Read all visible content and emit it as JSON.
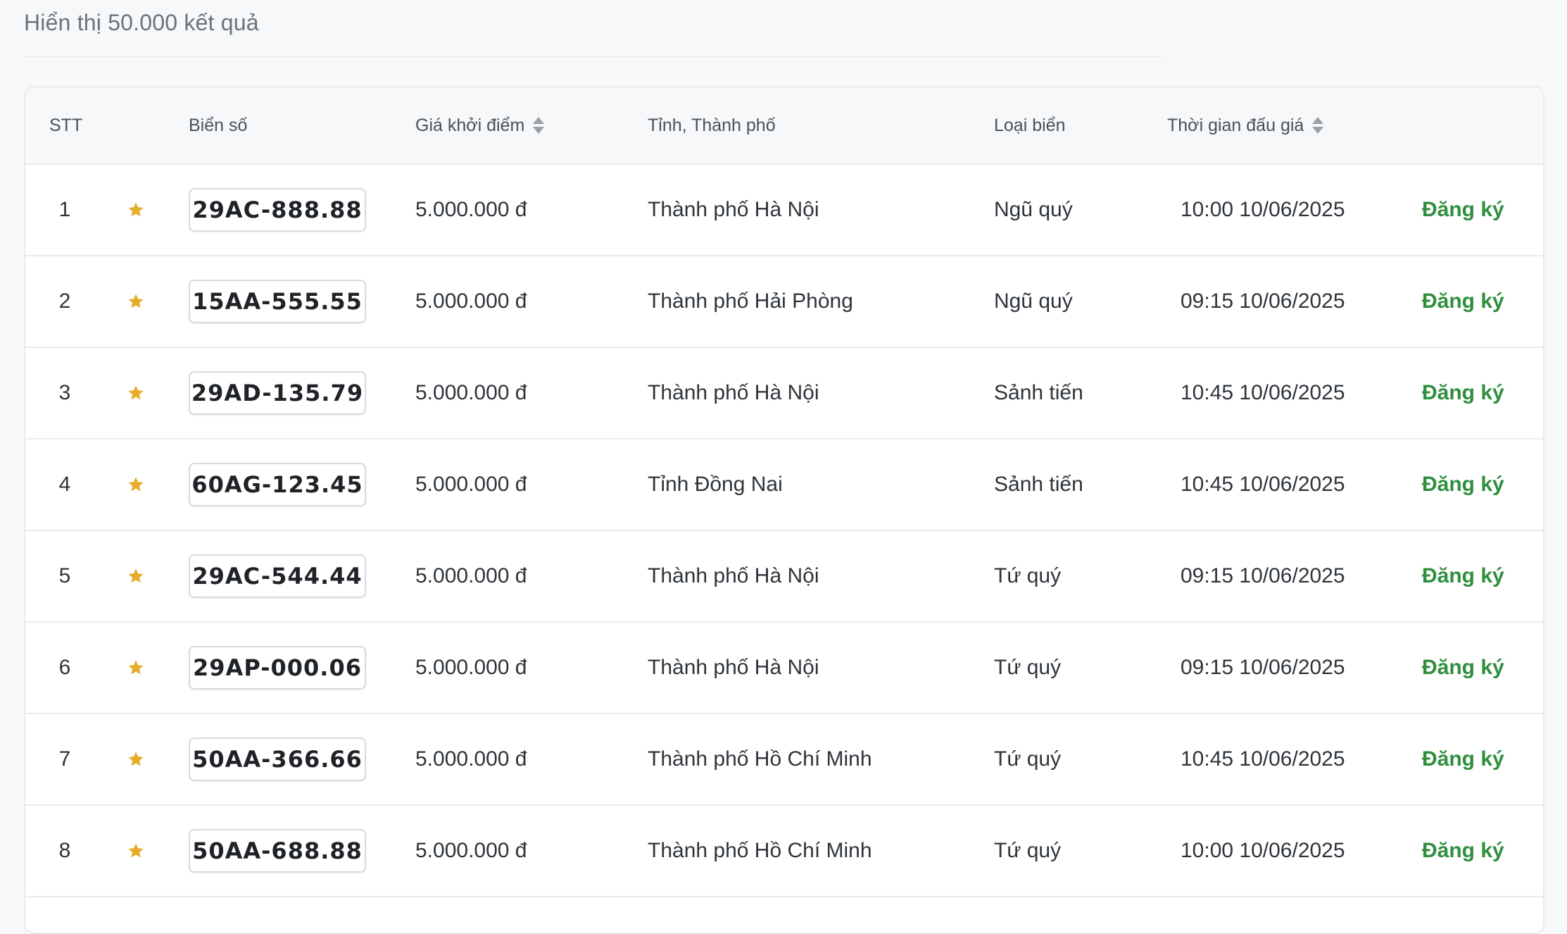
{
  "summary": {
    "text": "Hiển thị 50.000 kết quả"
  },
  "colors": {
    "accent_green": "#2f8f3e",
    "star": "#e6ad2a"
  },
  "table": {
    "headers": {
      "stt": "STT",
      "plate": "Biển số",
      "price": "Giá khởi điểm",
      "province": "Tỉnh, Thành phố",
      "type": "Loại biển",
      "time": "Thời gian đấu giá"
    },
    "rows": [
      {
        "stt": "1",
        "plate": "29AC-888.88",
        "price": "5.000.000 đ",
        "province": "Thành phố Hà Nội",
        "type": "Ngũ quý",
        "time": "10:00 10/06/2025",
        "action": "Đăng ký"
      },
      {
        "stt": "2",
        "plate": "15AA-555.55",
        "price": "5.000.000 đ",
        "province": "Thành phố Hải Phòng",
        "type": "Ngũ quý",
        "time": "09:15 10/06/2025",
        "action": "Đăng ký"
      },
      {
        "stt": "3",
        "plate": "29AD-135.79",
        "price": "5.000.000 đ",
        "province": "Thành phố Hà Nội",
        "type": "Sảnh tiến",
        "time": "10:45 10/06/2025",
        "action": "Đăng ký"
      },
      {
        "stt": "4",
        "plate": "60AG-123.45",
        "price": "5.000.000 đ",
        "province": "Tỉnh Đồng Nai",
        "type": "Sảnh tiến",
        "time": "10:45 10/06/2025",
        "action": "Đăng ký"
      },
      {
        "stt": "5",
        "plate": "29AC-544.44",
        "price": "5.000.000 đ",
        "province": "Thành phố Hà Nội",
        "type": "Tứ quý",
        "time": "09:15 10/06/2025",
        "action": "Đăng ký"
      },
      {
        "stt": "6",
        "plate": "29AP-000.06",
        "price": "5.000.000 đ",
        "province": "Thành phố Hà Nội",
        "type": "Tứ quý",
        "time": "09:15 10/06/2025",
        "action": "Đăng ký"
      },
      {
        "stt": "7",
        "plate": "50AA-366.66",
        "price": "5.000.000 đ",
        "province": "Thành phố Hồ Chí Minh",
        "type": "Tứ quý",
        "time": "10:45 10/06/2025",
        "action": "Đăng ký"
      },
      {
        "stt": "8",
        "plate": "50AA-688.88",
        "price": "5.000.000 đ",
        "province": "Thành phố Hồ Chí Minh",
        "type": "Tứ quý",
        "time": "10:00 10/06/2025",
        "action": "Đăng ký"
      }
    ]
  }
}
